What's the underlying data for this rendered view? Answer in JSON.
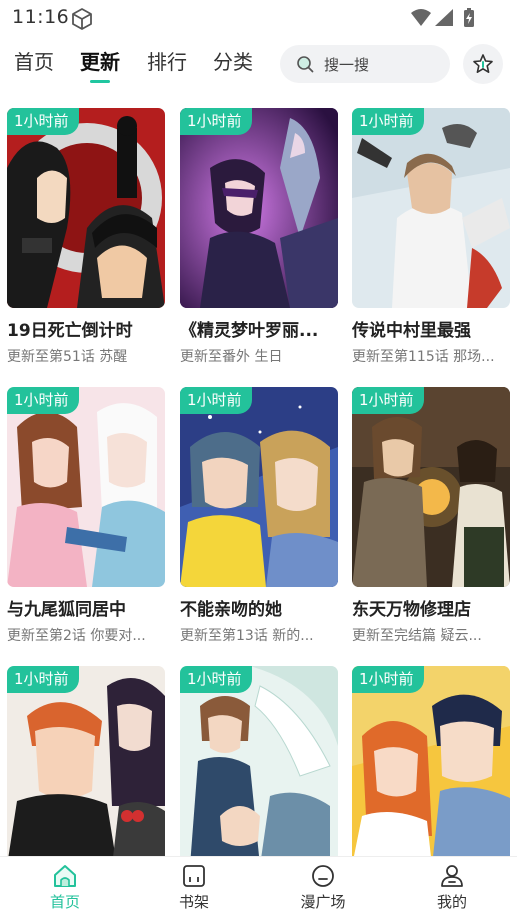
{
  "status": {
    "time": "11:16"
  },
  "tabs": [
    {
      "label": "首页"
    },
    {
      "label": "更新"
    },
    {
      "label": "排行"
    },
    {
      "label": "分类"
    }
  ],
  "search": {
    "placeholder": "搜一搜"
  },
  "cards": [
    {
      "badge": "1小时前",
      "title": "19日死亡倒计时",
      "subtitle": "更新至第51话 苏醒"
    },
    {
      "badge": "1小时前",
      "title": "《精灵梦叶罗丽...",
      "subtitle": "更新至番外 生日"
    },
    {
      "badge": "1小时前",
      "title": "传说中村里最强",
      "subtitle": "更新至第115话 那场..."
    },
    {
      "badge": "1小时前",
      "title": "与九尾狐同居中",
      "subtitle": "更新至第2话 你要对..."
    },
    {
      "badge": "1小时前",
      "title": "不能亲吻的她",
      "subtitle": "更新至第13话 新的..."
    },
    {
      "badge": "1小时前",
      "title": "东天万物修理店",
      "subtitle": "更新至完结篇 疑云..."
    },
    {
      "badge": "1小时前",
      "title": "",
      "subtitle": ""
    },
    {
      "badge": "1小时前",
      "title": "",
      "subtitle": ""
    },
    {
      "badge": "1小时前",
      "title": "",
      "subtitle": ""
    }
  ],
  "bottom_nav": [
    {
      "label": "首页",
      "icon": "home-icon"
    },
    {
      "label": "书架",
      "icon": "bookshelf-icon"
    },
    {
      "label": "漫广场",
      "icon": "plaza-icon"
    },
    {
      "label": "我的",
      "icon": "profile-icon"
    }
  ],
  "colors": {
    "accent": "#23c29b"
  }
}
